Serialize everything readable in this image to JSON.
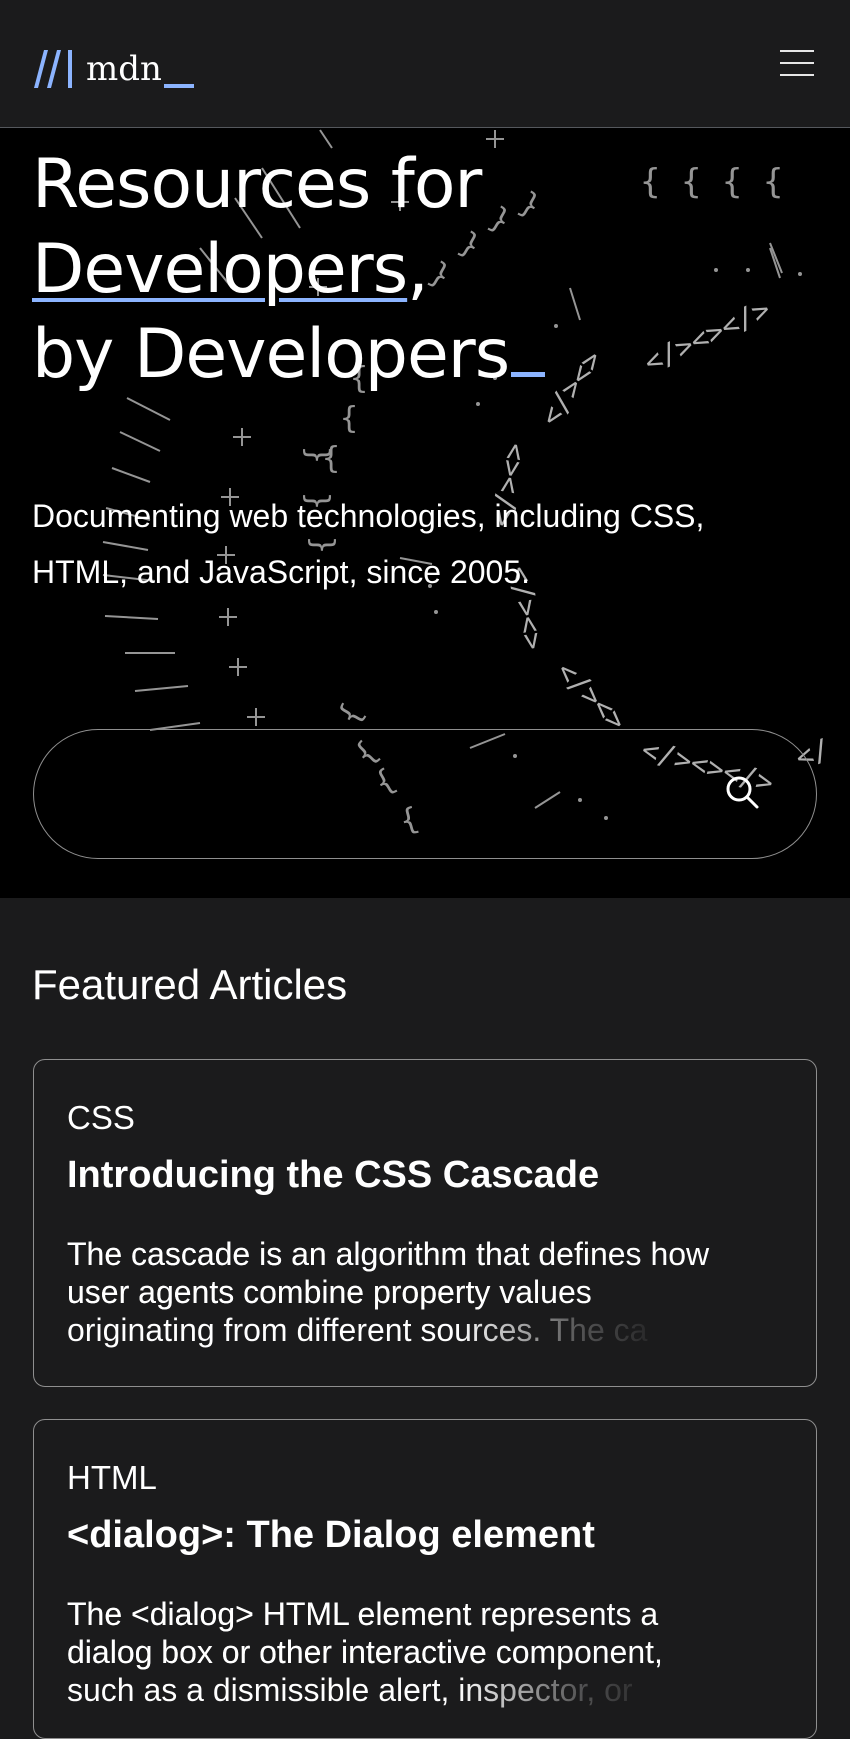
{
  "header": {
    "logo_text": "mdn",
    "menu_icon": "hamburger-menu-icon"
  },
  "hero": {
    "title_line1": "Resources for",
    "title_line2_word": "Developers",
    "title_line2_comma": ",",
    "title_line3": "by Developers",
    "subtitle": "Documenting web technologies, including CSS, HTML, and JavaScript, since 2005.",
    "search": {
      "placeholder": "",
      "value": "",
      "icon": "search-icon"
    }
  },
  "featured": {
    "heading": "Featured Articles",
    "articles": [
      {
        "tag": "CSS",
        "title": "Introducing the CSS Cascade",
        "desc_line1": "The cascade is an algorithm that defines how",
        "desc_line2": "user agents combine property values",
        "desc_line3": "originating from different sources. The ca"
      },
      {
        "tag": "HTML",
        "title": "<dialog>: The Dialog element",
        "desc_line1": "The <dialog> HTML element represents a",
        "desc_line2": "dialog box or other interactive component,",
        "desc_line3": "such as a dismissible alert, inspector, or"
      }
    ]
  },
  "colors": {
    "background": "#1b1b1c",
    "hero_background": "#000000",
    "accent": "#8cb4ff"
  }
}
